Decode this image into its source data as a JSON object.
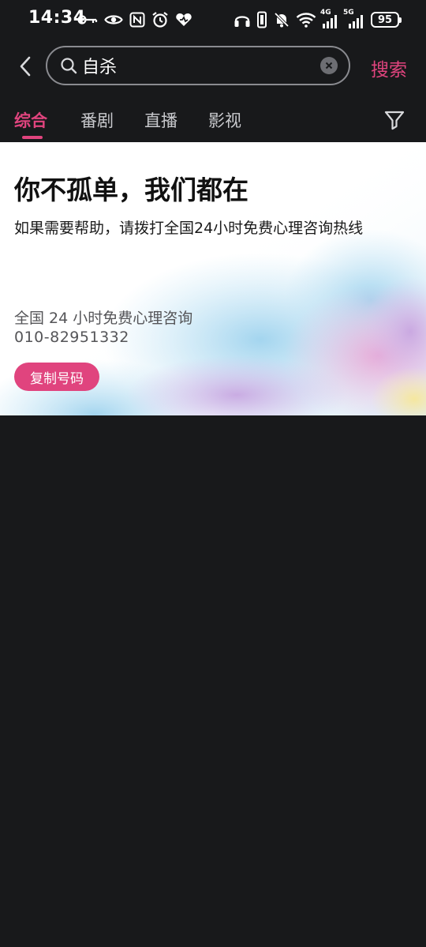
{
  "status_bar": {
    "time": "14:34",
    "left_icons": [
      "key-icon",
      "eye-icon",
      "nfc-icon",
      "alarm-icon",
      "heart-icon"
    ],
    "right_icons": [
      "headphones-icon",
      "vibrate-icon",
      "mute-icon",
      "wifi-icon",
      "signal-4g-icon",
      "signal-5g-icon"
    ],
    "network_4g": "4G",
    "network_5g": "5G",
    "battery": "95"
  },
  "search": {
    "query": "自杀",
    "submit_label": "搜索"
  },
  "tabs": [
    {
      "label": "综合",
      "active": true
    },
    {
      "label": "番剧",
      "active": false
    },
    {
      "label": "直播",
      "active": false
    },
    {
      "label": "影视",
      "active": false
    }
  ],
  "help_card": {
    "title": "你不孤单，我们都在",
    "subtitle": "如果需要帮助，请拨打全国24小时免费心理咨询热线",
    "hotline_label": "全国 24 小时免费心理咨询",
    "hotline_number": "010-82951332",
    "copy_button": "复制号码"
  },
  "colors": {
    "accent": "#e0447e",
    "background": "#18191b",
    "card": "#ffffff"
  }
}
